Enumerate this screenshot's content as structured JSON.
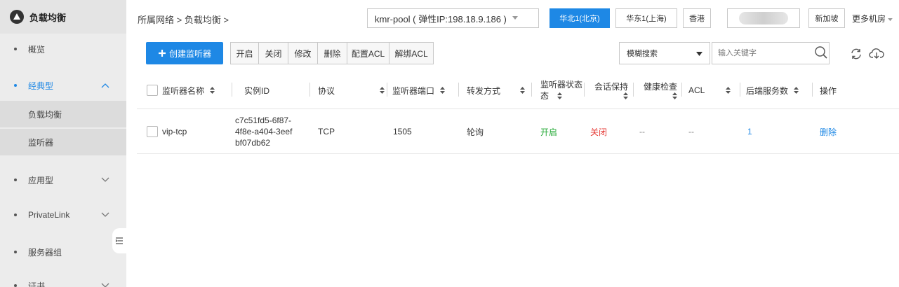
{
  "sidebar": {
    "title": "负载均衡",
    "items": [
      {
        "label": "概览"
      },
      {
        "label": "经典型"
      },
      {
        "label": "应用型"
      },
      {
        "label": "PrivateLink"
      },
      {
        "label": "服务器组"
      },
      {
        "label": "证书"
      }
    ],
    "sub_items": [
      {
        "label": "负载均衡"
      },
      {
        "label": "监听器"
      }
    ]
  },
  "topbar": {
    "breadcrumb": "所属网络 > 负载均衡 >",
    "pool_select": "kmr-pool ( 弹性IP:198.18.9.186 )",
    "regions": [
      "华北1(北京)",
      "华东1(上海)",
      "香港",
      "新加坡"
    ],
    "more": "更多机房"
  },
  "toolbar": {
    "create_label": "创建监听器",
    "actions": [
      "开启",
      "关闭",
      "修改",
      "删除",
      "配置ACL",
      "解绑ACL"
    ],
    "search_type": "模糊搜索",
    "search_placeholder": "输入关键字"
  },
  "table": {
    "headers": [
      "监听器名称",
      "实例ID",
      "协议",
      "监听器端口",
      "转发方式",
      "监听器状态",
      "会话保持",
      "健康检查",
      "ACL",
      "后端服务数",
      "操作"
    ],
    "header_status_line2": "态",
    "rows": [
      {
        "name": "vip-tcp",
        "id_lines": [
          "c7c51fd5-6f87-",
          "4f8e-a404-3eef",
          "bf07db62"
        ],
        "protocol": "TCP",
        "port": "1505",
        "method": "轮询",
        "status": "开启",
        "session": "关闭",
        "health": "--",
        "acl": "--",
        "backends": "1",
        "action": "删除"
      }
    ]
  },
  "colors": {
    "accent": "#1e88e5",
    "on": "#22a834",
    "off": "#e53935"
  }
}
